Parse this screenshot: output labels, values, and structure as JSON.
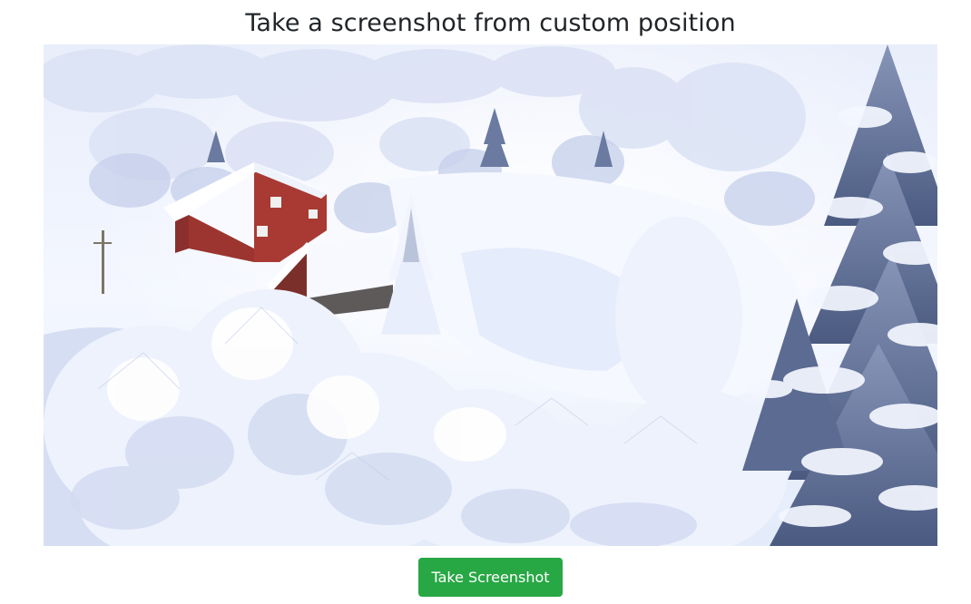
{
  "page": {
    "title": "Take a screenshot from custom position"
  },
  "video": {
    "scene": "snow-covered-hillside-with-red-cabins"
  },
  "actions": {
    "take_screenshot_label": "Take Screenshot",
    "button_color": "#28a745"
  },
  "colors": {
    "title_text": "#212529",
    "button_text": "#ffffff"
  }
}
